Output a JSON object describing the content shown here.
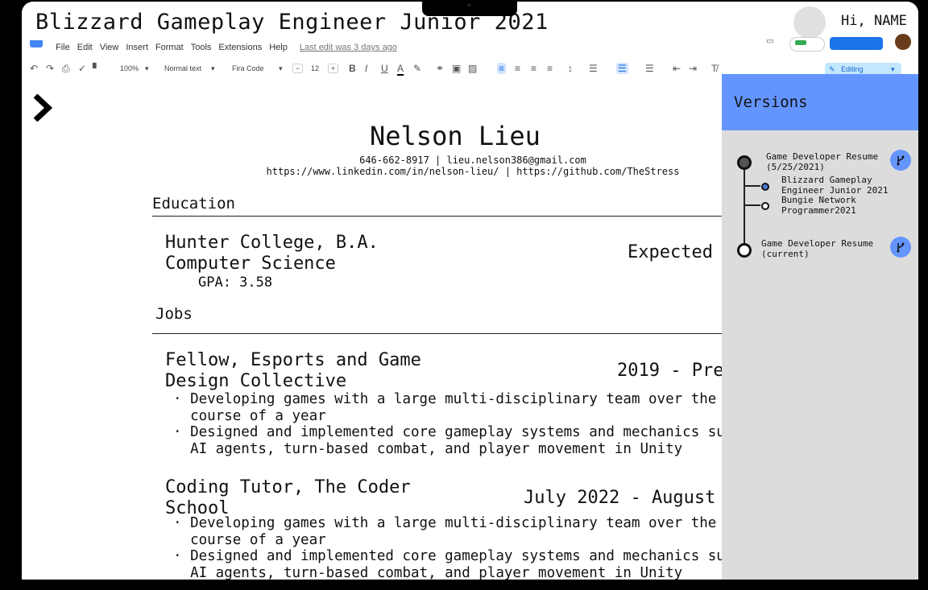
{
  "window": {
    "title": "Blizzard Gameplay Engineer Junior 2021",
    "greeting": "Hi, NAME"
  },
  "menu": {
    "items": [
      "File",
      "Edit",
      "View",
      "Insert",
      "Format",
      "Tools",
      "Extensions",
      "Help"
    ],
    "last_edit": "Last edit was 3 days ago"
  },
  "toolbar": {
    "zoom": "100%",
    "style": "Normal text",
    "font": "Fira Code",
    "font_size": "12",
    "editing_mode": "Editing"
  },
  "resume": {
    "name": "Nelson Lieu",
    "contact_line1": "646-662-8917 | lieu.nelson386@gmail.com",
    "contact_line2": "https://www.linkedin.com/in/nelson-lieu/ | https://github.com/TheStress",
    "education_heading": "Education",
    "education": {
      "title": "Hunter College, B.A.\nComputer Science",
      "date": "Expected",
      "gpa": "GPA: 3.58"
    },
    "jobs_heading": "Jobs",
    "jobs": [
      {
        "title": "Fellow, Esports and Game\nDesign Collective",
        "date": "2019 - Pre",
        "bullets": [
          "· Developing games with a large multi-disciplinary team over the\n  course of a year",
          "· Designed and implemented core gameplay systems and mechanics suc\n  AI agents, turn-based combat, and player movement in Unity"
        ]
      },
      {
        "title": "Coding Tutor, The Coder\nSchool",
        "date": "July 2022 - August",
        "bullets": [
          "· Developing games with a large multi-disciplinary team over the\n  course of a year",
          "· Designed and implemented core gameplay systems and mechanics suc\n  AI agents, turn-based combat, and player movement in Unity"
        ]
      }
    ]
  },
  "versions": {
    "title": "Versions",
    "items": [
      {
        "label": "Game Developer Resume\n(5/25/2021)"
      },
      {
        "label": "Blizzard Gameplay\nEngineer Junior 2021"
      },
      {
        "label": "Bungie Network\nProgrammer2021"
      },
      {
        "label": "Game Developer Resume\n(current)"
      }
    ]
  }
}
